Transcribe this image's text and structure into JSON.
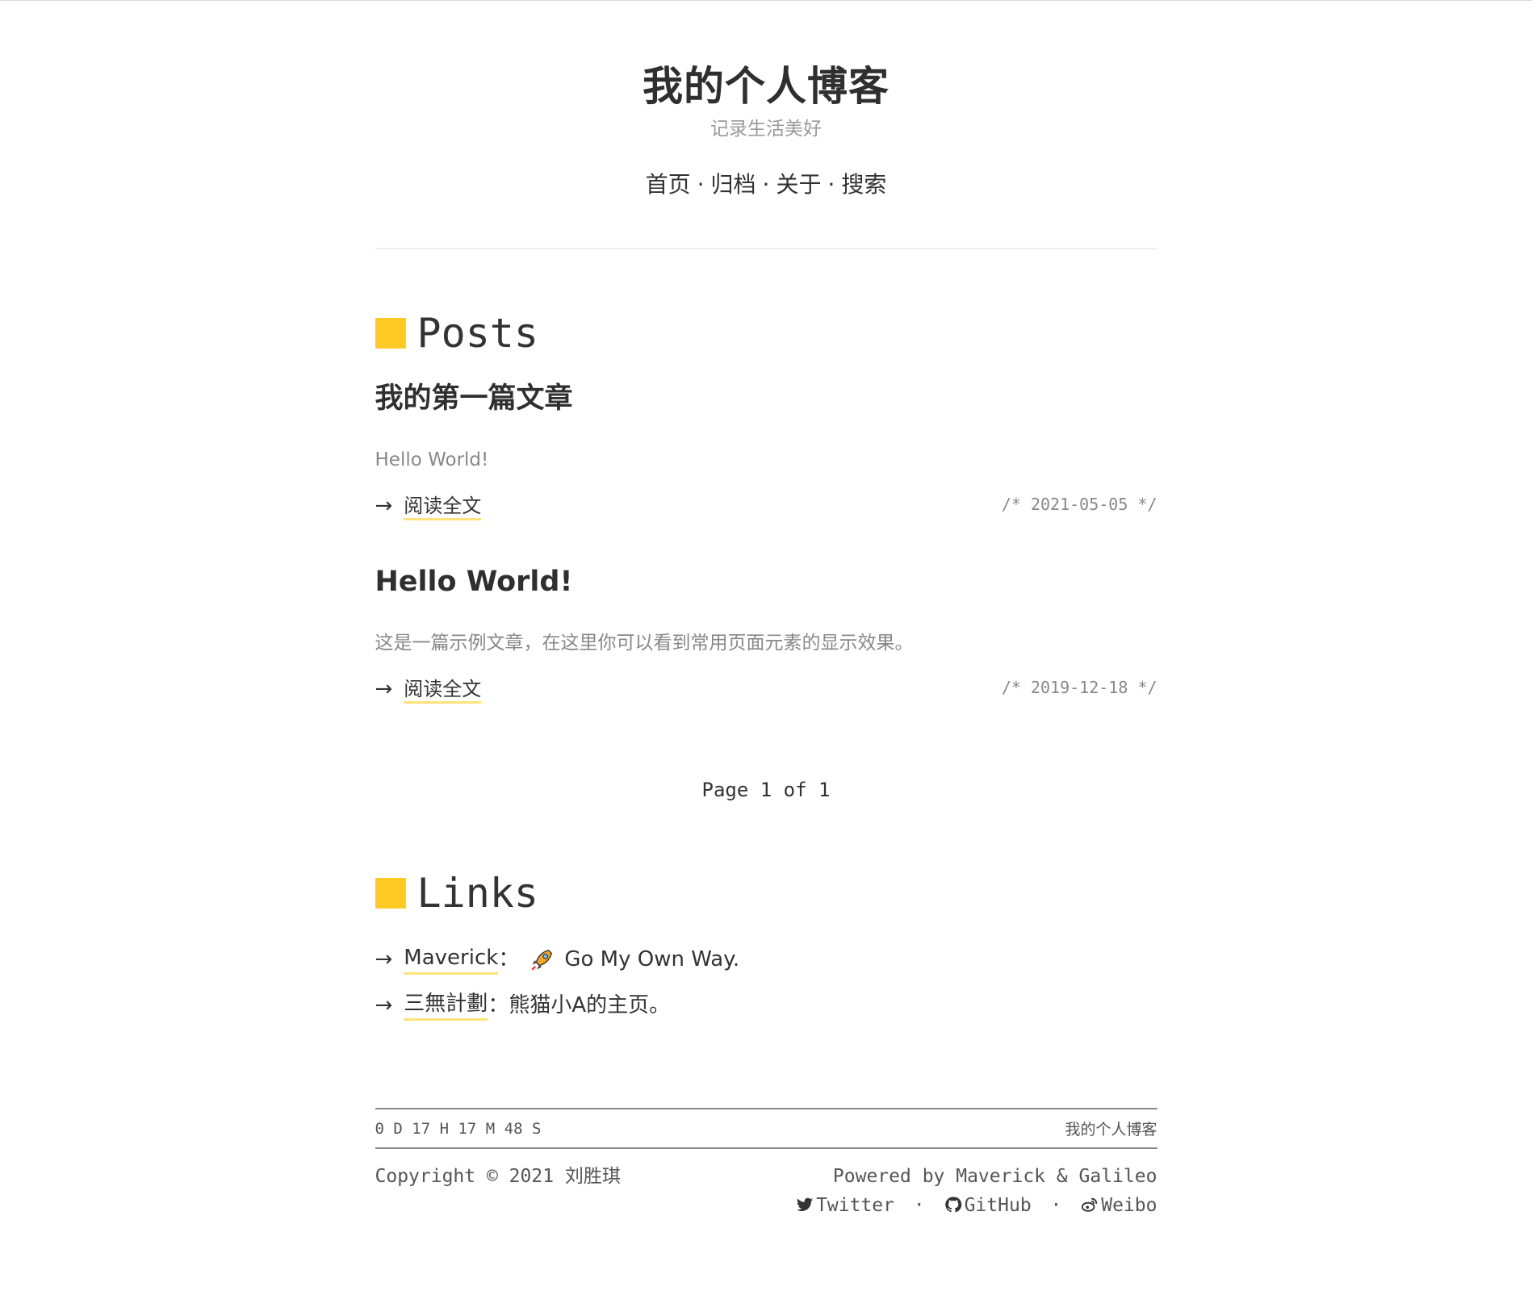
{
  "site": {
    "title": "我的个人博客",
    "subtitle": "记录生活美好"
  },
  "nav": {
    "items": [
      "首页",
      "归档",
      "关于",
      "搜索"
    ],
    "separator": "·"
  },
  "posts_section": {
    "heading": "Posts",
    "posts": [
      {
        "title": "我的第一篇文章",
        "excerpt": "Hello World!",
        "read_more": "阅读全文",
        "arrow": "→",
        "date": "/* 2021-05-05 */"
      },
      {
        "title": "Hello World!",
        "excerpt": "这是一篇示例文章，在这里你可以看到常用页面元素的显示效果。",
        "read_more": "阅读全文",
        "arrow": "→",
        "date": "/* 2019-12-18 */"
      }
    ],
    "pager": "Page 1 of 1"
  },
  "links_section": {
    "heading": "Links",
    "links": [
      {
        "arrow": "→",
        "name": "Maverick",
        "colon": "：",
        "icon": "rocket-emoji",
        "desc": "Go My Own Way."
      },
      {
        "arrow": "→",
        "name": "三無計劃",
        "colon": "：",
        "desc": "熊猫小A的主页。"
      }
    ]
  },
  "footer": {
    "timer": "0 D 17 H 17 M 48 S",
    "bar_title": "我的个人博客",
    "copyright": "Copyright © 2021 刘胜琪",
    "powered": "Powered by Maverick & Galileo",
    "social": [
      "Twitter",
      "GitHub",
      "Weibo"
    ],
    "separator": "·"
  },
  "colors": {
    "accent": "#ffc926",
    "underline": "#ffe27a",
    "text": "#333333",
    "muted": "#888888"
  }
}
